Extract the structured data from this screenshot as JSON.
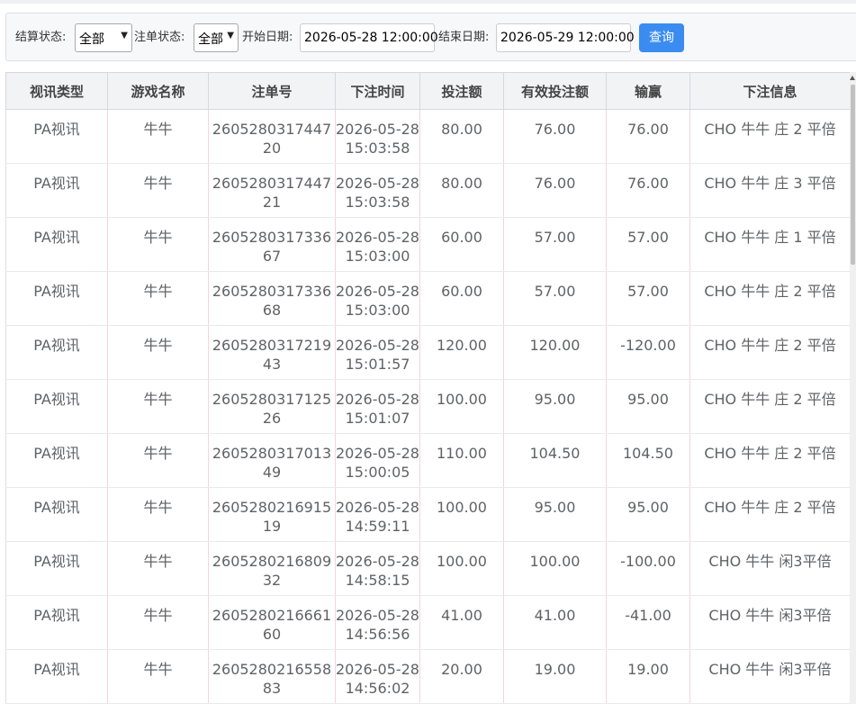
{
  "filters": {
    "settle_label": "结算状态:",
    "settle_value": "全部",
    "bet_status_label": "注单状态:",
    "bet_status_value": "全部",
    "start_label": "开始日期:",
    "start_value": "2026-05-28 12:00:00",
    "end_label": "结束日期:",
    "end_value": "2026-05-29 12:00:00",
    "query_label": "查询"
  },
  "table": {
    "columns": [
      "视讯类型",
      "游戏名称",
      "注单号",
      "下注时间",
      "投注额",
      "有效投注额",
      "输赢",
      "下注信息"
    ],
    "rows": [
      {
        "type": "PA视讯",
        "game": "牛牛",
        "order": "260528031744720",
        "time": "2026-05-28 15:03:58",
        "bet": "80.00",
        "valid": "76.00",
        "win": "76.00",
        "info": "CHO 牛牛 庄 2 平倍"
      },
      {
        "type": "PA视讯",
        "game": "牛牛",
        "order": "260528031744721",
        "time": "2026-05-28 15:03:58",
        "bet": "80.00",
        "valid": "76.00",
        "win": "76.00",
        "info": "CHO 牛牛 庄 3 平倍"
      },
      {
        "type": "PA视讯",
        "game": "牛牛",
        "order": "260528031733667",
        "time": "2026-05-28 15:03:00",
        "bet": "60.00",
        "valid": "57.00",
        "win": "57.00",
        "info": "CHO 牛牛 庄 1 平倍"
      },
      {
        "type": "PA视讯",
        "game": "牛牛",
        "order": "260528031733668",
        "time": "2026-05-28 15:03:00",
        "bet": "60.00",
        "valid": "57.00",
        "win": "57.00",
        "info": "CHO 牛牛 庄 2 平倍"
      },
      {
        "type": "PA视讯",
        "game": "牛牛",
        "order": "260528031721943",
        "time": "2026-05-28 15:01:57",
        "bet": "120.00",
        "valid": "120.00",
        "win": "-120.00",
        "info": "CHO 牛牛 庄 2 平倍"
      },
      {
        "type": "PA视讯",
        "game": "牛牛",
        "order": "260528031712526",
        "time": "2026-05-28 15:01:07",
        "bet": "100.00",
        "valid": "95.00",
        "win": "95.00",
        "info": "CHO 牛牛 庄 2 平倍"
      },
      {
        "type": "PA视讯",
        "game": "牛牛",
        "order": "260528031701349",
        "time": "2026-05-28 15:00:05",
        "bet": "110.00",
        "valid": "104.50",
        "win": "104.50",
        "info": "CHO 牛牛 庄 2 平倍"
      },
      {
        "type": "PA视讯",
        "game": "牛牛",
        "order": "260528021691519",
        "time": "2026-05-28 14:59:11",
        "bet": "100.00",
        "valid": "95.00",
        "win": "95.00",
        "info": "CHO 牛牛 庄 2 平倍"
      },
      {
        "type": "PA视讯",
        "game": "牛牛",
        "order": "260528021680932",
        "time": "2026-05-28 14:58:15",
        "bet": "100.00",
        "valid": "100.00",
        "win": "-100.00",
        "info": "CHO 牛牛 闲3平倍"
      },
      {
        "type": "PA视讯",
        "game": "牛牛",
        "order": "260528021666160",
        "time": "2026-05-28 14:56:56",
        "bet": "41.00",
        "valid": "41.00",
        "win": "-41.00",
        "info": "CHO 牛牛 闲3平倍"
      },
      {
        "type": "PA视讯",
        "game": "牛牛",
        "order": "260528021655883",
        "time": "2026-05-28 14:56:02",
        "bet": "20.00",
        "valid": "19.00",
        "win": "19.00",
        "info": "CHO 牛牛 闲3平倍"
      }
    ]
  }
}
